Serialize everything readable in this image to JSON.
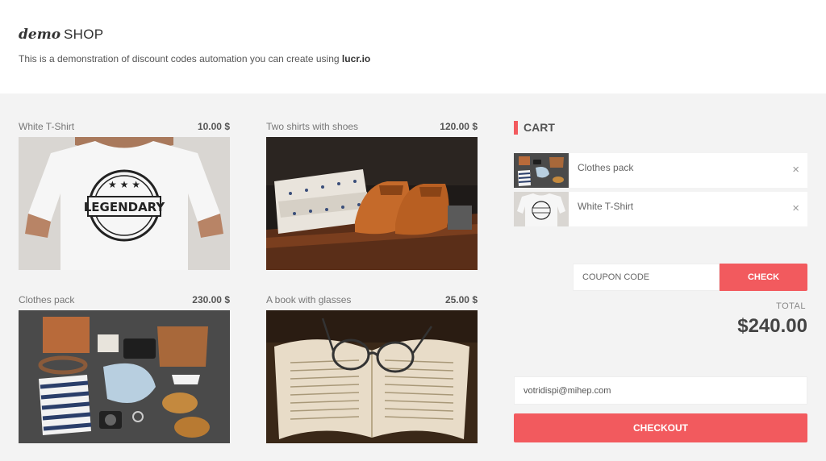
{
  "header": {
    "brand_demo": "demo",
    "brand_shop": "SHOP",
    "tagline_prefix": "This is a demonstration of discount codes automation you can create using ",
    "tagline_link": "lucr.io"
  },
  "products": [
    {
      "name": "White T-Shirt",
      "price": "10.00 $",
      "image": "white-tshirt-legendary-icon"
    },
    {
      "name": "Two shirts with shoes",
      "price": "120.00 $",
      "image": "shirts-and-shoes-icon"
    },
    {
      "name": "Clothes pack",
      "price": "230.00 $",
      "image": "clothes-pack-flatlay-icon"
    },
    {
      "name": "A book with glasses",
      "price": "25.00 $",
      "image": "book-with-glasses-icon"
    }
  ],
  "cart": {
    "title": "CART",
    "items": [
      {
        "name": "Clothes pack",
        "remove": "×"
      },
      {
        "name": "White T-Shirt",
        "remove": "×"
      }
    ],
    "coupon_placeholder": "COUPON CODE",
    "check_label": "CHECK",
    "total_label": "TOTAL",
    "total_value": "$240.00",
    "email_value": "votridispi@mihep.com",
    "checkout_label": "CHECKOUT"
  },
  "colors": {
    "accent": "#f25a5e",
    "background": "#f3f3f3",
    "panel": "#ffffff"
  }
}
